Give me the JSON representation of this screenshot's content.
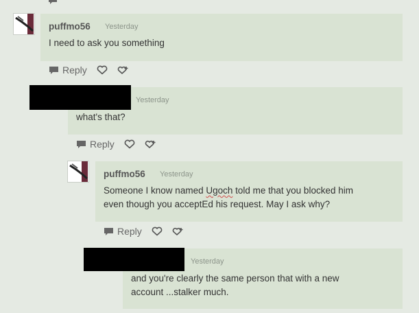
{
  "comments": [
    {
      "username": "puffmo56",
      "timestamp": "Yesterday",
      "message": "I need to ask you something",
      "reply_label": "Reply"
    },
    {
      "username": "",
      "timestamp": "Yesterday",
      "message": "what's that?",
      "reply_label": "Reply"
    },
    {
      "username": "puffmo56",
      "timestamp": "Yesterday",
      "message_pre": "Someone I know named ",
      "message_flagged_word": "Ugoch",
      "message_line1_post": " told me that you blocked him",
      "message_line2": "even though you acceptEd his request. May I ask why?",
      "reply_label": "Reply"
    },
    {
      "username": "",
      "timestamp": "Yesterday",
      "message_line1": "and you're clearly the same person that with a new",
      "message_line2": "account ...stalker much."
    }
  ],
  "icons": {
    "reply": "speech-bubble-icon",
    "like": "heart-icon",
    "report": "flag-heart-icon"
  },
  "colors": {
    "background": "#e5eae3",
    "bubble": "#d9e3d3",
    "username": "#555555",
    "timestamp": "#8c948a"
  }
}
